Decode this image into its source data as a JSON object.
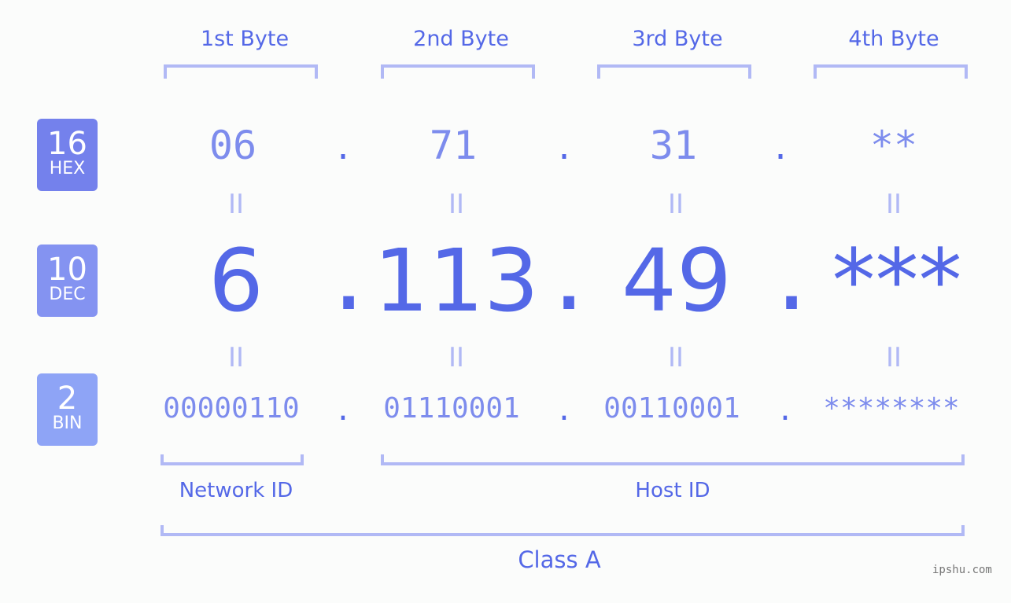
{
  "bytes": [
    {
      "label": "1st Byte",
      "hex": "06",
      "dec": "6",
      "bin": "00000110"
    },
    {
      "label": "2nd Byte",
      "hex": "71",
      "dec": "113",
      "bin": "01110001"
    },
    {
      "label": "3rd Byte",
      "hex": "31",
      "dec": "49",
      "bin": "00110001"
    },
    {
      "label": "4th Byte",
      "hex": "**",
      "dec": "***",
      "bin": "********"
    }
  ],
  "badges": {
    "hex": {
      "num": "16",
      "name": "HEX",
      "color": "#7481ec"
    },
    "dec": {
      "num": "10",
      "name": "DEC",
      "color": "#8493f1"
    },
    "bin": {
      "num": "2",
      "name": "BIN",
      "color": "#8ea4f6"
    }
  },
  "separator": ".",
  "equals": "II",
  "groups": {
    "network": "Network ID",
    "host": "Host ID",
    "class": "Class A"
  },
  "watermark": "ipshu.com",
  "colors": {
    "primary": "#5468e7",
    "secondary": "#7d8ced",
    "bracket": "#b1b9f5"
  }
}
